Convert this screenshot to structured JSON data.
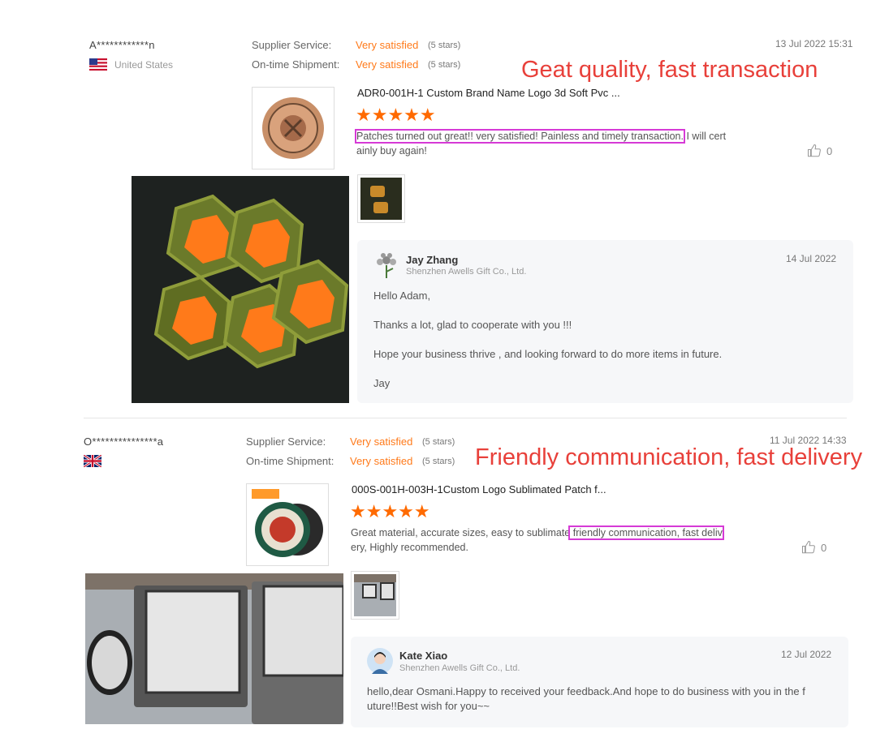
{
  "reviews": [
    {
      "buyer": "A************n",
      "country": "United States",
      "supplier_service_label": "Supplier Service:",
      "supplier_service_value": "Very satisfied",
      "supplier_service_stars": "(5 stars)",
      "ontime_label": "On-time Shipment:",
      "ontime_value": "Very satisfied",
      "ontime_stars": "(5 stars)",
      "date": "13 Jul 2022 15:31",
      "annotation": "Geat quality, fast transaction",
      "product_title": "ADR0-001H-1 Custom Brand Name Logo 3d Soft Pvc ...",
      "rating": 5,
      "review_highlight": "Patches turned out great!! very satisfied! Painless and timely transaction.",
      "review_rest_1": " I will cert",
      "review_rest_2": "ainly buy again!",
      "likes": "0",
      "reply": {
        "name": "Jay Zhang",
        "company": "Shenzhen Awells Gift Co., Ltd.",
        "date": "14 Jul 2022",
        "lines": [
          "Hello  Adam,",
          "Thanks a lot, glad to cooperate with you !!!",
          "Hope your business thrive , and looking forward to do more items in future.",
          "Jay"
        ]
      }
    },
    {
      "buyer": "O***************a",
      "country": "",
      "supplier_service_label": "Supplier Service:",
      "supplier_service_value": "Very satisfied",
      "supplier_service_stars": "(5 stars)",
      "ontime_label": "On-time Shipment:",
      "ontime_value": "Very satisfied",
      "ontime_stars": "(5 stars)",
      "date": "11 Jul 2022 14:33",
      "annotation": "Friendly communication, fast delivery",
      "product_title": "000S-001H-003H-1Custom Logo Sublimated Patch f...",
      "rating": 5,
      "review_before": "Great material, accurate sizes, easy to sublimate",
      "review_highlight": " friendly communication, fast deliv",
      "review_rest_2": "ery, Highly recommended.",
      "likes": "0",
      "reply": {
        "name": "Kate Xiao",
        "company": "Shenzhen Awells Gift Co., Ltd.",
        "date": "12 Jul 2022",
        "lines": [
          "hello,dear  Osmani.Happy   to received your feedback.And hope to do business with you in the f",
          "uture!!Best  wish for you~~"
        ]
      }
    }
  ],
  "star_glyphs": "★★★★★",
  "icons": {
    "like": "thumbs-up-icon",
    "flag_us": "us-flag-icon",
    "flag_uk": "uk-flag-icon"
  },
  "colors": {
    "accent": "#ff7a1a",
    "annotation": "#e8403a",
    "highlight": "#d63ad6"
  }
}
